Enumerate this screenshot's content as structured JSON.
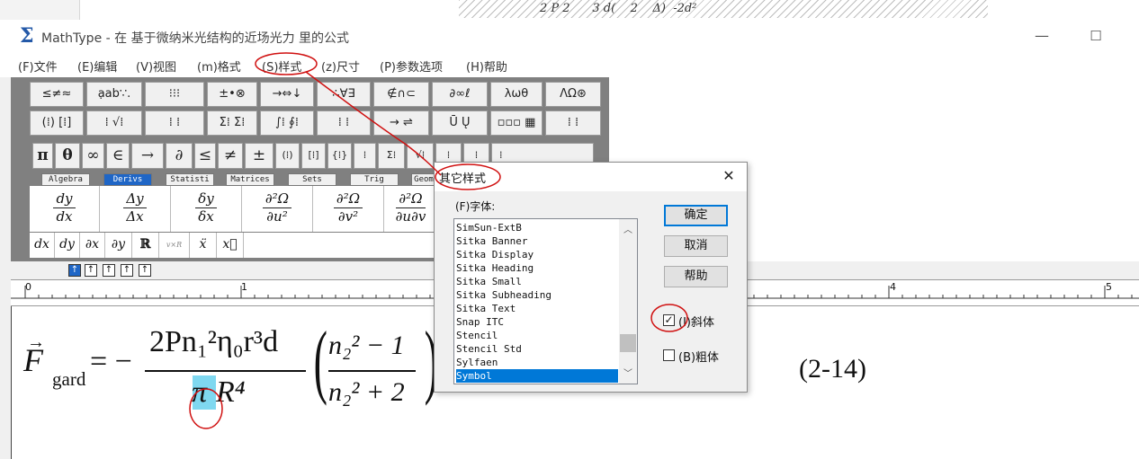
{
  "doc_fragment": "2 P 2      3 d(    2    Δ)  -2d²",
  "window": {
    "title": "MathType - 在 基于微纳米光结构的近场光力 里的公式",
    "minimize": "—",
    "maximize": "☐"
  },
  "menu": [
    "(F)文件",
    "(E)编辑",
    "(V)视图",
    "(m)格式",
    "(S)样式",
    "(z)尺寸",
    "(P)参数选项",
    "(H)帮助"
  ],
  "toolbar_row1": [
    "≤≠≈",
    "ạab∵.",
    "⁝⁝⁝",
    "±•⊗",
    "→⇔↓",
    "∴∀∃",
    "∉∩⊂",
    "∂∞ℓ",
    "λωθ",
    "ΛΩ⊛"
  ],
  "toolbar_row2": [
    "(⁞) [⁞]",
    "⁞ √⁞",
    "⁞ ⁞",
    "Σ⁞ Σ⁞",
    "∫⁞ ∮⁞",
    "⁞ ⁞",
    "→ ⇌",
    "Ū Ų",
    "▫▫▫ ▦",
    "⁞ ⁞"
  ],
  "toolbar_row3": [
    "π",
    "θ",
    "∞",
    "∈",
    "→",
    "∂",
    "≤",
    "≠",
    "±",
    "(⁞)",
    "[⁞]",
    "{⁞}",
    "⁞",
    "Σ⁞",
    "√⁞",
    "⁞",
    "⁞",
    "⁞"
  ],
  "tabs": [
    "Algebra",
    "Derivs",
    "Statisti",
    "Matrices",
    "Sets",
    "Trig",
    "Geom"
  ],
  "active_tab": "Derivs",
  "templates": [
    {
      "num": "dy",
      "den": "dx"
    },
    {
      "num": "Δy",
      "den": "Δx"
    },
    {
      "num": "δy",
      "den": "δx"
    },
    {
      "num": "∂²Ω",
      "den": "∂u²"
    },
    {
      "num": "∂²Ω",
      "den": "∂v²"
    },
    {
      "num": "∂²Ω",
      "den": "∂u∂v"
    }
  ],
  "small_templates": [
    "dx",
    "dy",
    "∂x",
    "∂y",
    "ℝ",
    "v×R",
    "ẍ",
    "x⃛"
  ],
  "nav_buttons": [
    "↑",
    "↑",
    "↑",
    "↑",
    "↑"
  ],
  "ruler_marks": [
    "0",
    "1",
    "4",
    "5"
  ],
  "formula": {
    "F": "F",
    "sub": "gard",
    "eq": "= −",
    "numerator": "2Pn₁²η₀r³d",
    "denominator_pi": "π",
    "denominator_rest": "R⁴",
    "paren_num": "n₂² − 1",
    "paren_den": "n₂² + 2",
    "eq_number": "(2-14)"
  },
  "dialog": {
    "title": "其它样式",
    "close": "✕",
    "font_label": "(F)字体:",
    "fonts": [
      "SimSun-ExtB",
      "Sitka Banner",
      "Sitka Display",
      "Sitka Heading",
      "Sitka Small",
      "Sitka Subheading",
      "Sitka Text",
      "Snap ITC",
      "Stencil",
      "Stencil Std",
      "Sylfaen",
      "Symbol"
    ],
    "selected_font": "Symbol",
    "ok": "确定",
    "cancel": "取消",
    "help": "帮助",
    "italic_label": "(I)斜体",
    "italic_checked": true,
    "bold_label": "(B)粗体",
    "bold_checked": false
  },
  "colors": {
    "accent": "#1f66c6",
    "selection": "#0078d7",
    "annotation": "#d01010",
    "highlight": "#7fd8f0"
  }
}
